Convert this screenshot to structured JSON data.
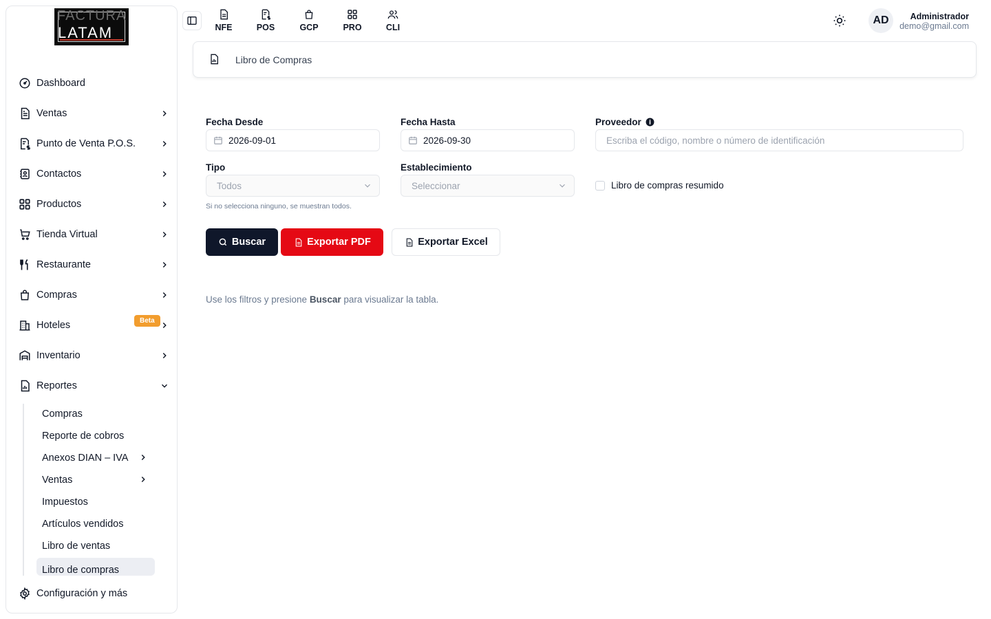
{
  "brand": {
    "logo_line1": "FACTURA",
    "logo_line2": "LATAM"
  },
  "sidebar": {
    "items": [
      {
        "label": "Dashboard",
        "icon": "dashboard-icon",
        "has_chevron": false
      },
      {
        "label": "Ventas",
        "icon": "document-icon",
        "has_chevron": true
      },
      {
        "label": "Punto de Venta P.O.S.",
        "icon": "receipt-dollar-icon",
        "has_chevron": true
      },
      {
        "label": "Contactos",
        "icon": "contacts-icon",
        "has_chevron": true
      },
      {
        "label": "Productos",
        "icon": "grid-icon",
        "has_chevron": true
      },
      {
        "label": "Tienda Virtual",
        "icon": "cart-icon",
        "has_chevron": true
      },
      {
        "label": "Restaurante",
        "icon": "utensils-icon",
        "has_chevron": true
      },
      {
        "label": "Compras",
        "icon": "shopping-bag-icon",
        "has_chevron": true
      },
      {
        "label": "Hoteles",
        "icon": "building-icon",
        "has_chevron": true,
        "badge": "Beta"
      },
      {
        "label": "Inventario",
        "icon": "warehouse-icon",
        "has_chevron": true
      },
      {
        "label": "Reportes",
        "icon": "report-icon",
        "has_chevron": true,
        "expanded": true
      }
    ],
    "reportes_sub": [
      {
        "label": "Compras",
        "has_chevron": false
      },
      {
        "label": "Reporte de cobros",
        "has_chevron": false
      },
      {
        "label": "Anexos DIAN – IVA",
        "has_chevron": true
      },
      {
        "label": "Ventas",
        "has_chevron": true
      },
      {
        "label": "Impuestos",
        "has_chevron": false
      },
      {
        "label": "Artículos vendidos",
        "has_chevron": false
      },
      {
        "label": "Libro de ventas",
        "has_chevron": false
      },
      {
        "label": "Libro de compras",
        "has_chevron": false,
        "active": true
      }
    ],
    "footer": {
      "label": "Configuración y más",
      "icon": "gear-icon"
    }
  },
  "topbar": {
    "tabs": [
      {
        "label": "NFE",
        "icon": "document-icon"
      },
      {
        "label": "POS",
        "icon": "receipt-dollar-icon"
      },
      {
        "label": "GCP",
        "icon": "shopping-bag-icon"
      },
      {
        "label": "PRO",
        "icon": "grid-icon"
      },
      {
        "label": "CLI",
        "icon": "users-icon"
      }
    ],
    "user": {
      "initials": "AD",
      "name": "Administrador",
      "email": "demo@gmail.com"
    }
  },
  "page": {
    "title": "Libro de Compras",
    "filters": {
      "fecha_desde_label": "Fecha Desde",
      "fecha_desde_value": "2026-09-01",
      "fecha_hasta_label": "Fecha Hasta",
      "fecha_hasta_value": "2026-09-30",
      "proveedor_label": "Proveedor",
      "proveedor_placeholder": "Escriba el código, nombre o número de identificación",
      "tipo_label": "Tipo",
      "tipo_value": "Todos",
      "tipo_helper": "Si no selecciona ninguno, se muestran todos.",
      "establecimiento_label": "Establecimiento",
      "establecimiento_value": "Seleccionar",
      "resumido_label": "Libro de compras resumido"
    },
    "buttons": {
      "search": "Buscar",
      "pdf": "Exportar PDF",
      "excel": "Exportar Excel"
    },
    "hint": {
      "before": "Use los filtros y presione ",
      "bold": "Buscar",
      "after": " para visualizar la tabla."
    }
  },
  "colors": {
    "primary": "#0f172a",
    "pdf": "#e50914",
    "badge": "#f29d2e",
    "active_bg": "#eceef3"
  }
}
